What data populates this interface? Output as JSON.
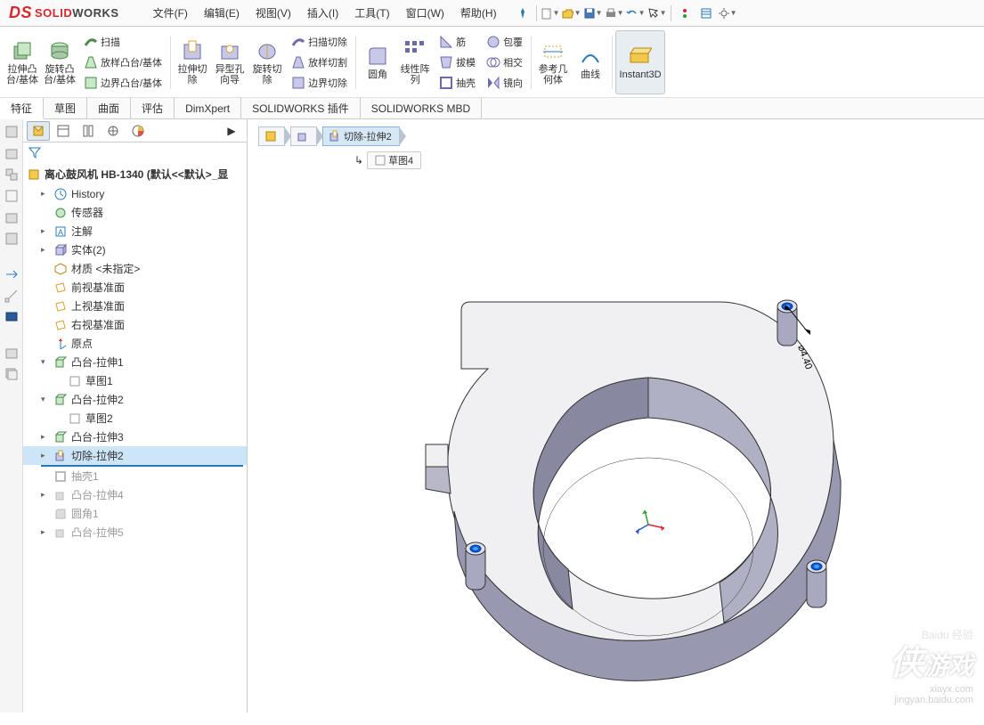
{
  "app": {
    "brand_solid": "SOLID",
    "brand_works": "WORKS"
  },
  "menu": {
    "file": "文件(F)",
    "edit": "编辑(E)",
    "view": "视图(V)",
    "insert": "插入(I)",
    "tools": "工具(T)",
    "window": "窗口(W)",
    "help": "帮助(H)"
  },
  "ribbon": {
    "extrude": "拉伸凸台/基体",
    "revolve": "旋转凸台/基体",
    "sweep": "扫描",
    "loft": "放样凸台/基体",
    "boundary": "边界凸台/基体",
    "cut_extrude": "拉伸切除",
    "hole_wizard": "异型孔向导",
    "cut_revolve": "旋转切除",
    "cut_sweep": "扫描切除",
    "cut_loft": "放样切割",
    "cut_boundary": "边界切除",
    "fillet": "圆角",
    "linear_pattern": "线性阵列",
    "rib": "筋",
    "draft": "拔模",
    "shell": "抽壳",
    "wrap": "包覆",
    "intersect": "相交",
    "mirror": "镜向",
    "ref_geom": "参考几何体",
    "curves": "曲线",
    "instant3d": "Instant3D"
  },
  "tabs": {
    "t0": "特征",
    "t1": "草图",
    "t2": "曲面",
    "t3": "评估",
    "t4": "DimXpert",
    "t5": "SOLIDWORKS 插件",
    "t6": "SOLIDWORKS MBD"
  },
  "tree": {
    "root": "离心鼓风机 HB-1340  (默认<<默认>_显",
    "history": "History",
    "sensors": "传感器",
    "annotations": "注解",
    "solids": "实体(2)",
    "material": "材质 <未指定>",
    "plane_front": "前视基准面",
    "plane_top": "上视基准面",
    "plane_right": "右视基准面",
    "origin": "原点",
    "boss1": "凸台-拉伸1",
    "sketch1": "草图1",
    "boss2": "凸台-拉伸2",
    "sketch2": "草图2",
    "boss3": "凸台-拉伸3",
    "cut2": "切除-拉伸2",
    "shell1": "抽壳1",
    "boss4": "凸台-拉伸4",
    "fillet1": "圆角1",
    "boss5": "凸台-拉伸5"
  },
  "breadcrumb": {
    "active": "切除-拉伸2",
    "sub": "草图4"
  },
  "dimension": "4.40",
  "watermark": {
    "brand": "侠",
    "brand2": "游戏",
    "site": "xiayx.com",
    "baidu": "jingyan.baidu.com"
  }
}
